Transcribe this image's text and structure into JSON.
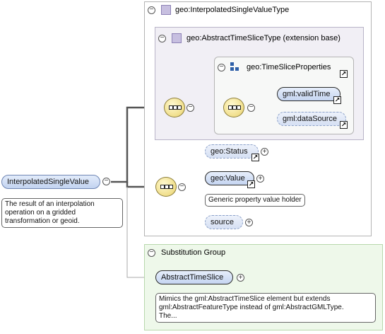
{
  "root_element": {
    "name": "InterpolatedSingleValue",
    "annotation": [
      "The result of an interpolation",
      "operation on a gridded",
      "transformation or geoid."
    ]
  },
  "type_box": {
    "title": "geo:InterpolatedSingleValueType",
    "base": {
      "title": "geo:AbstractTimeSliceType (extension base)",
      "group": {
        "title": "geo:TimeSliceProperties",
        "elements": [
          "gml:validTime",
          "gml:dataSource"
        ]
      }
    },
    "elements": {
      "status": "geo:Status",
      "value": "geo:Value",
      "value_annotation": "Generic property value holder",
      "source": "source"
    }
  },
  "substitution": {
    "title": "Substitution Group",
    "element": "AbstractTimeSlice",
    "annotation": [
      "Mimics the gml:AbstractTimeSlice element but extends",
      "gml:AbstractFeatureType instead of gml:AbstractGMLType.",
      "The..."
    ]
  },
  "glyphs": {
    "collapse": "⊖",
    "expand": "+",
    "minus": "−",
    "ref_arrow": "↗"
  }
}
